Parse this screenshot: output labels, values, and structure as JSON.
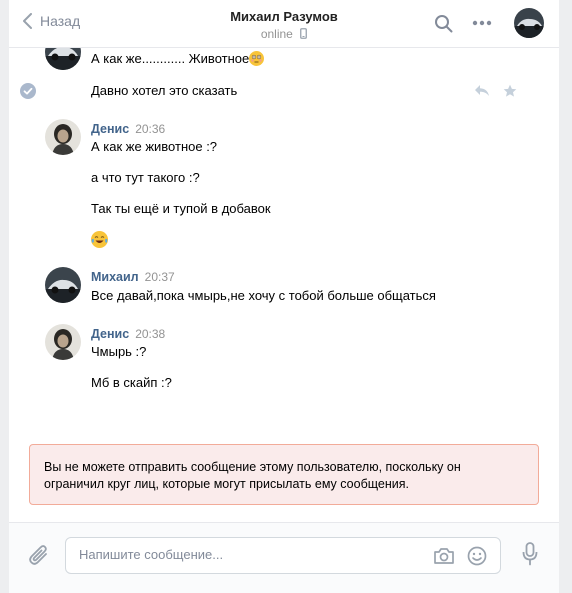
{
  "header": {
    "back_label": "Назад",
    "contact_name": "Михаил Разумов",
    "status": "online"
  },
  "messages": {
    "partial_line": "А как же............ Животное",
    "pending_line": "Давно хотел это сказать",
    "groups": [
      {
        "author": "Денис",
        "time": "20:36",
        "lines": [
          "А как же животное :?",
          "а что тут такого :?",
          "Так ты ещё и тупой в добавок"
        ]
      },
      {
        "author": "Михаил",
        "time": "20:37",
        "lines": [
          "Все давай,пока чмырь,не хочу с тобой больше общаться"
        ]
      },
      {
        "author": "Денис",
        "time": "20:38",
        "lines": [
          "Чмырь :?",
          "Мб в скайп :?"
        ]
      }
    ]
  },
  "notice": {
    "text": "Вы не можете отправить сообщение этому пользователю, поскольку он ограничил круг лиц, которые могут присылать ему сообщения."
  },
  "composer": {
    "placeholder": "Напишите сообщение..."
  },
  "colors": {
    "link": "#42648b",
    "muted": "#939393",
    "notice_bg": "#faebeb",
    "notice_border": "#f2ab99"
  }
}
